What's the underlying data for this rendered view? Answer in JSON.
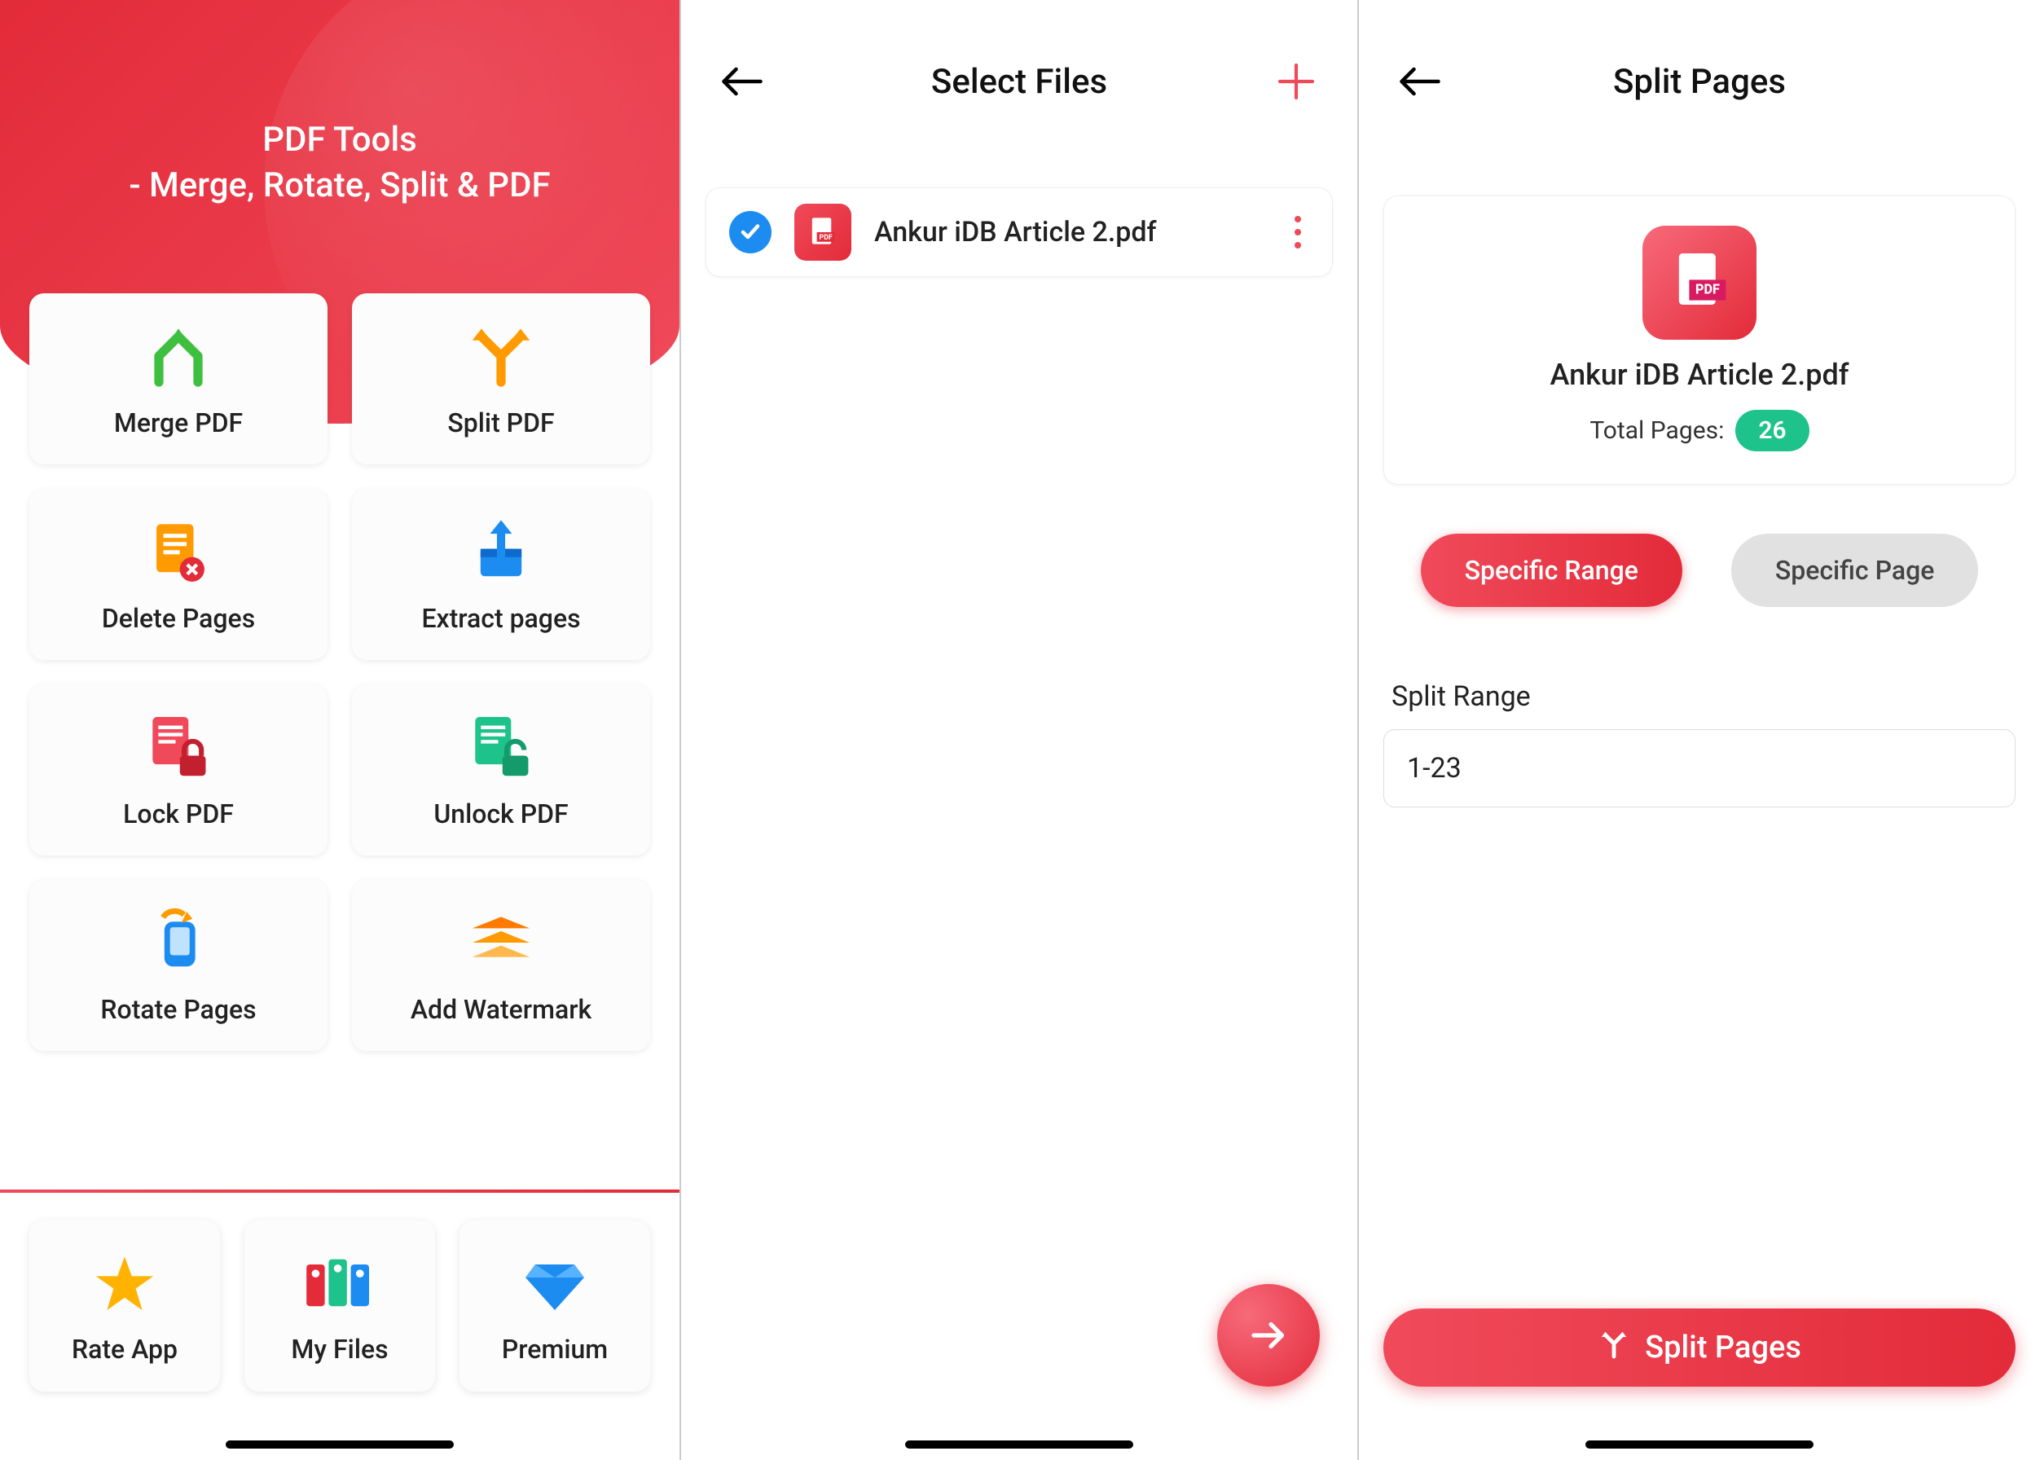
{
  "screen1": {
    "title": "PDF Tools",
    "subtitle": "- Merge, Rotate, Split & PDF",
    "tools": [
      {
        "label": "Merge PDF"
      },
      {
        "label": "Split PDF"
      },
      {
        "label": "Delete Pages"
      },
      {
        "label": "Extract pages"
      },
      {
        "label": "Lock PDF"
      },
      {
        "label": "Unlock PDF"
      },
      {
        "label": "Rotate Pages"
      },
      {
        "label": "Add Watermark"
      }
    ],
    "bottom": [
      {
        "label": "Rate App"
      },
      {
        "label": "My Files"
      },
      {
        "label": "Premium"
      }
    ]
  },
  "screen2": {
    "title": "Select Files",
    "file_name": "Ankur iDB Article 2.pdf"
  },
  "screen3": {
    "title": "Split Pages",
    "file_name": "Ankur iDB Article 2.pdf",
    "total_pages_label": "Total Pages:",
    "total_pages": "26",
    "seg_range": "Specific Range",
    "seg_page": "Specific Page",
    "split_range_label": "Split Range",
    "split_range_value": "1-23",
    "action": "Split Pages"
  }
}
